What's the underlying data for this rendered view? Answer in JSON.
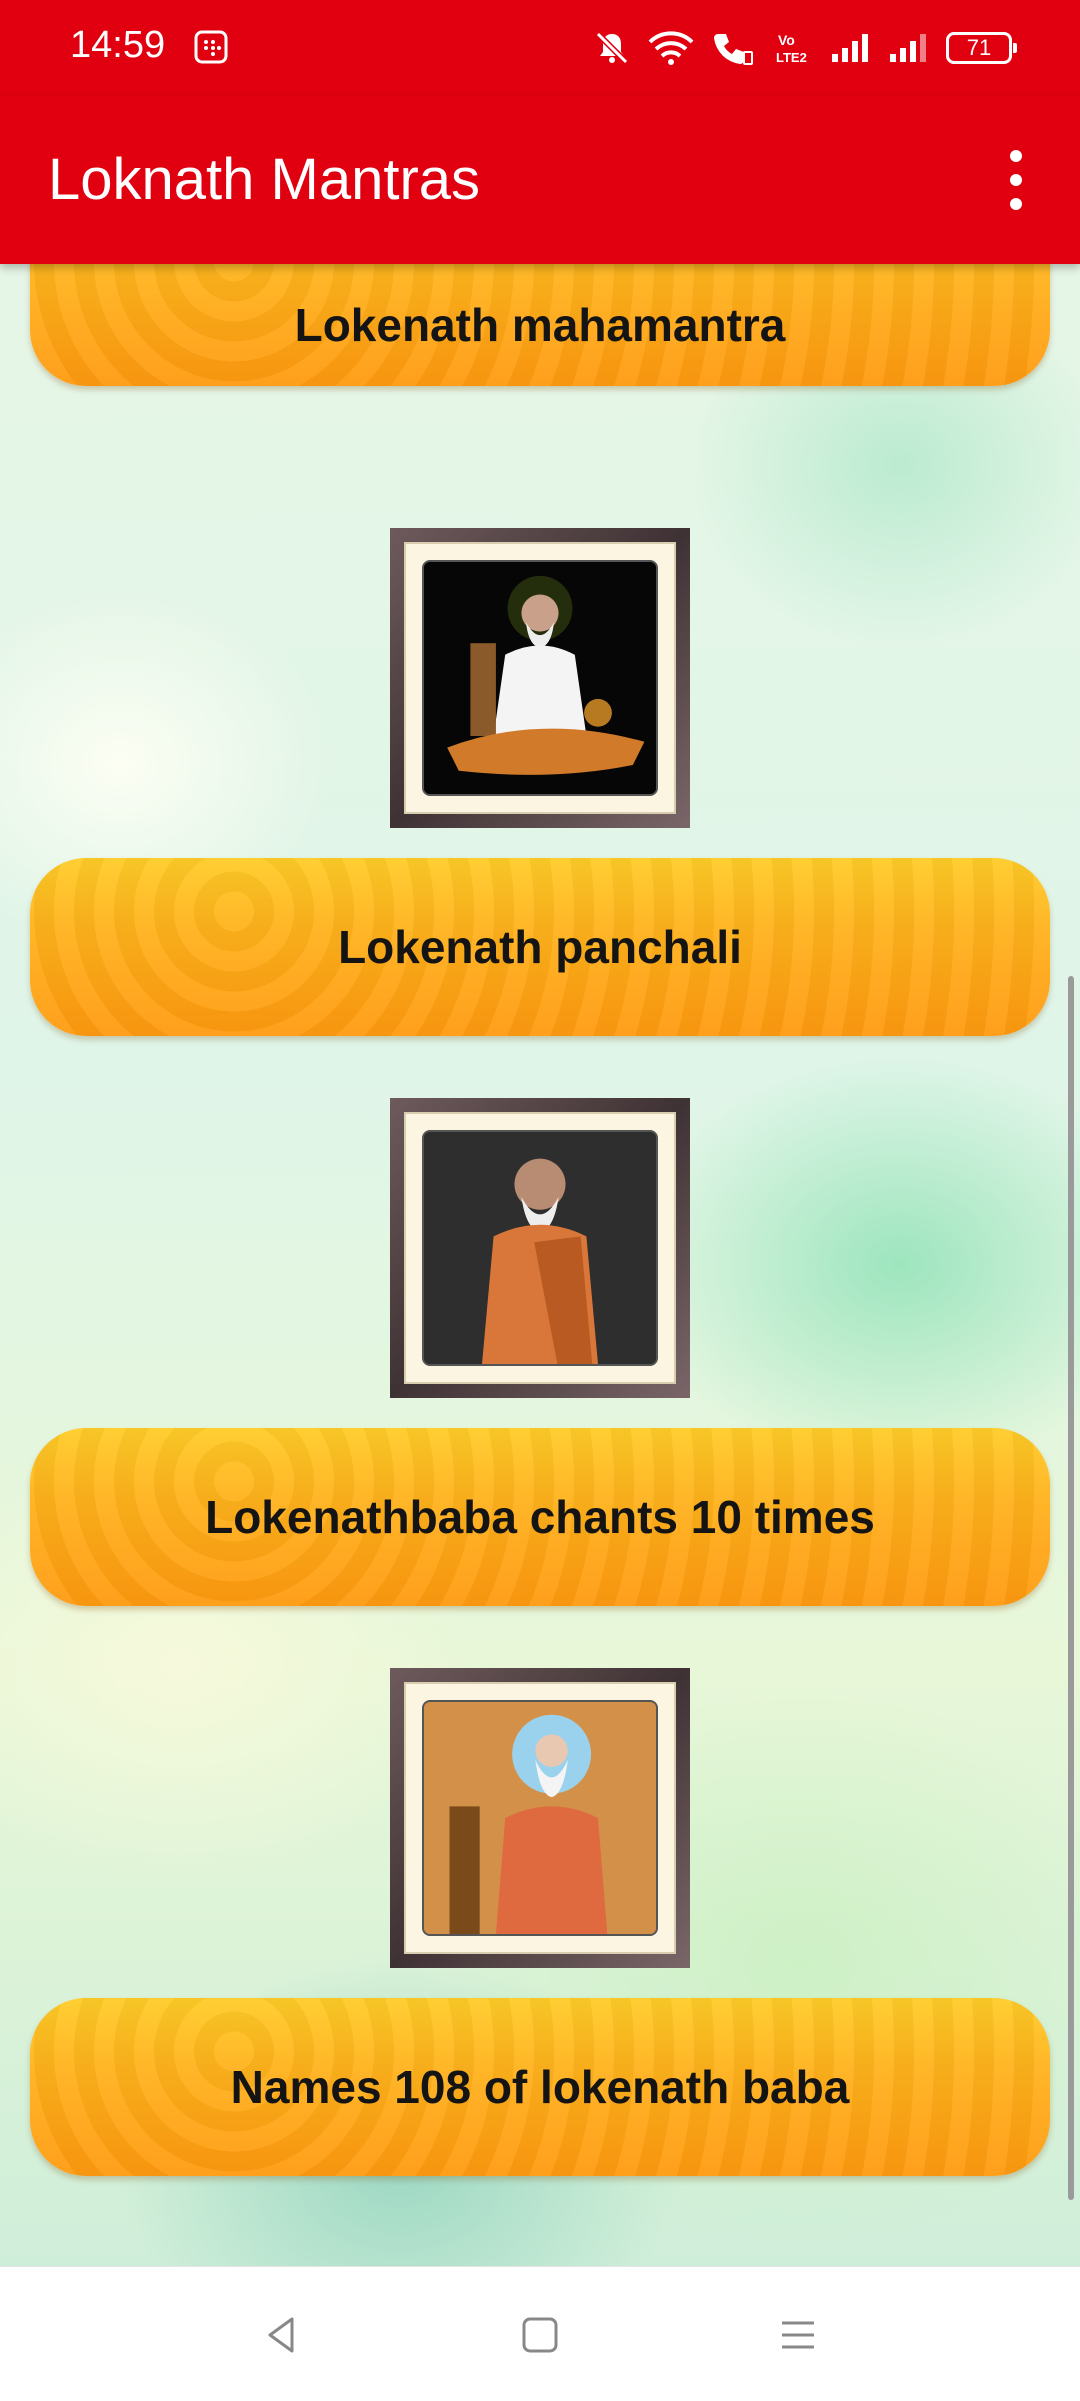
{
  "status_bar": {
    "time": "14:59",
    "battery": "71",
    "icons": [
      "notification-badge-icon",
      "mute-icon",
      "wifi-icon",
      "wifi-calling-icon",
      "volte-icon",
      "signal-icon",
      "signal-icon-2",
      "battery-icon"
    ]
  },
  "app_bar": {
    "title": "Loknath Mantras",
    "menu_icon": "more-vert-icon"
  },
  "colors": {
    "app_bar": "#e00010",
    "button_top": "#ffcc28",
    "button_bottom": "#ff9a10"
  },
  "items": [
    {
      "label": "Lokenath mahamantra",
      "image": "loknath-baba-seated-photo"
    },
    {
      "label": "Lokenath panchali",
      "image": "loknath-baba-standing-photo"
    },
    {
      "label": "Lokenathbaba chants 10 times",
      "image": "loknath-baba-painting"
    },
    {
      "label": "Names 108 of lokenath baba"
    }
  ],
  "nav_bar": {
    "back_icon": "back-icon",
    "home_icon": "home-icon",
    "recents_icon": "recents-menu-icon"
  }
}
